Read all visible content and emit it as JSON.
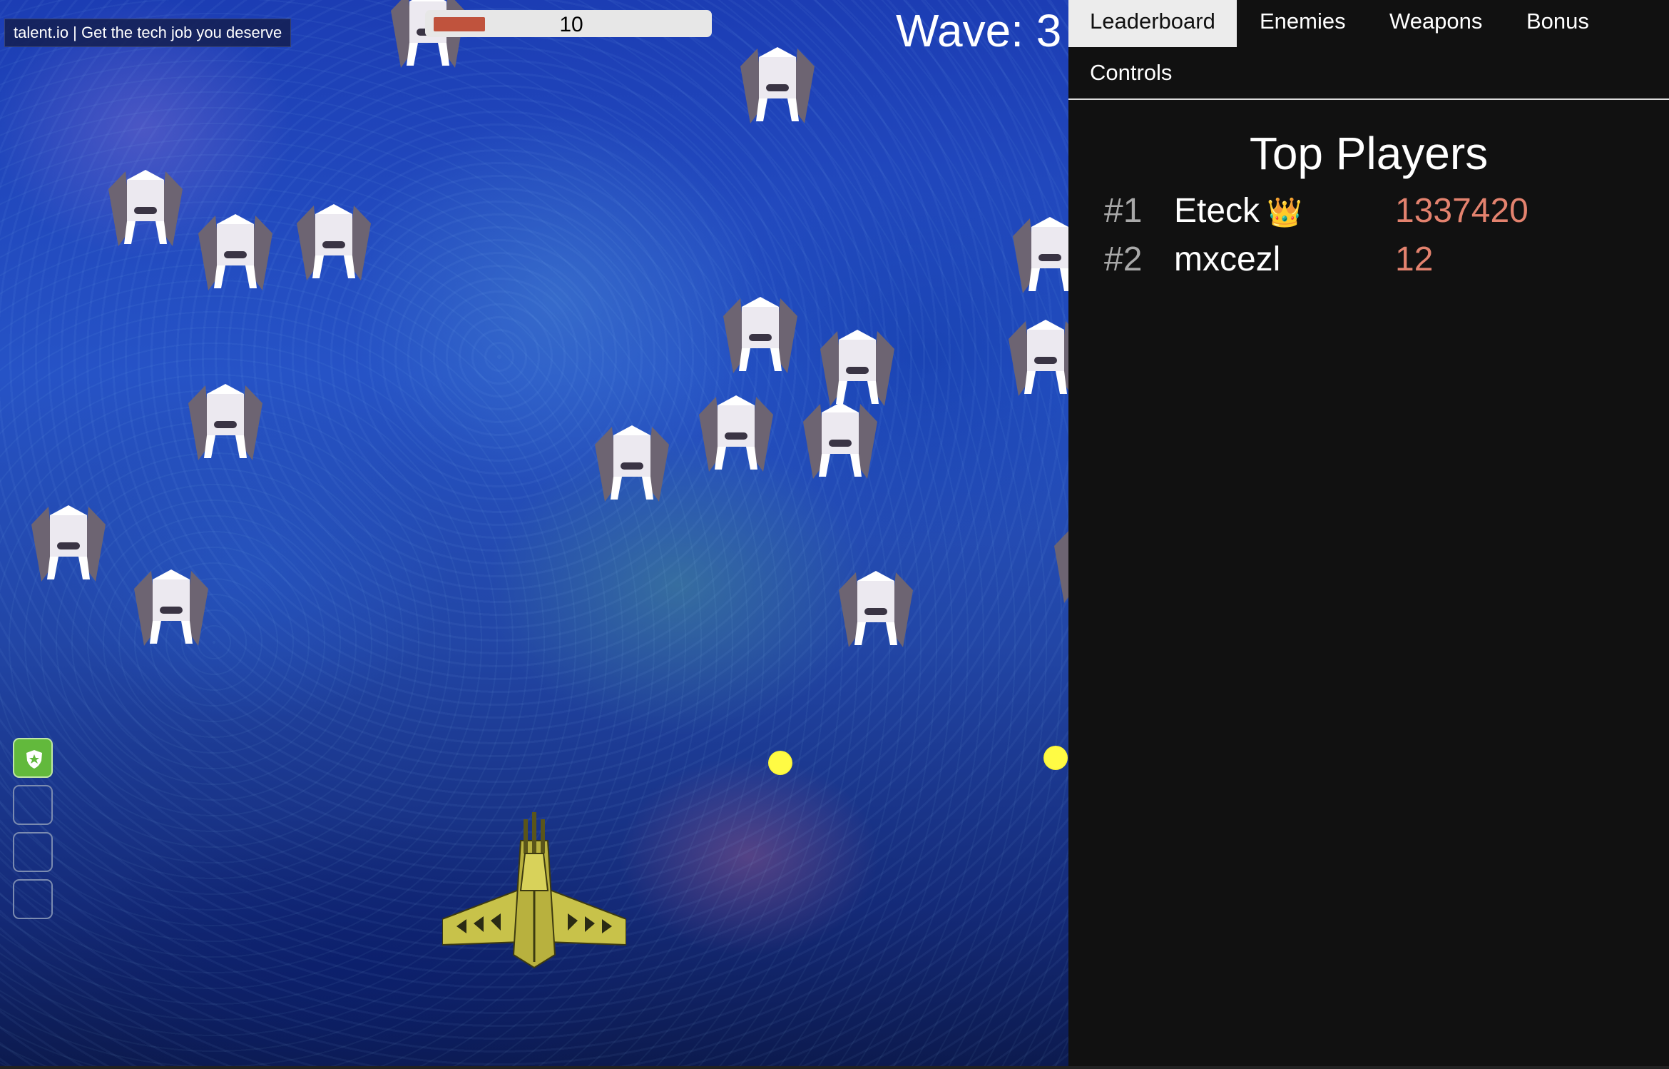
{
  "sponsor": {
    "text": "talent.io | Get the tech job you deserve"
  },
  "hud": {
    "health_value": "10",
    "health_fraction": 0.19,
    "wave_label": "Wave: 3"
  },
  "powerup_slots": [
    {
      "state": "active",
      "icon": "shield-star-icon"
    },
    {
      "state": "empty"
    },
    {
      "state": "empty"
    },
    {
      "state": "empty"
    }
  ],
  "tabs": [
    {
      "label": "Leaderboard",
      "selected": true
    },
    {
      "label": "Enemies",
      "selected": false
    },
    {
      "label": "Weapons",
      "selected": false
    },
    {
      "label": "Bonus",
      "selected": false
    },
    {
      "label": "Controls",
      "selected": false
    }
  ],
  "leaderboard": {
    "title": "Top Players",
    "rows": [
      {
        "rank": "#1",
        "name": "Eteck",
        "badge": "👑",
        "score": "1337420"
      },
      {
        "rank": "#2",
        "name": "mxcezl",
        "badge": "",
        "score": "12"
      }
    ]
  },
  "colors": {
    "score": "#e3826e",
    "rank": "#a9a9a9",
    "health_fill": "#c0533d",
    "powerup_active": "#62b93c",
    "bullet": "#fffb44",
    "ship": "#c8c24a"
  }
}
